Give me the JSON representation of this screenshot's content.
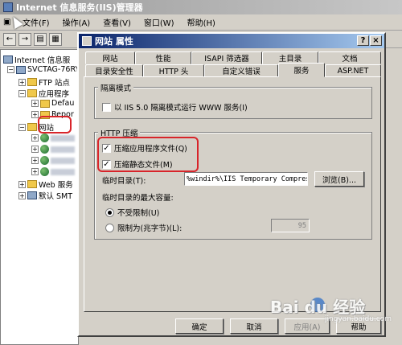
{
  "main_window": {
    "title": "Internet 信息服务(IIS)管理器",
    "menu": [
      "文件(F)",
      "操作(A)",
      "查看(V)",
      "窗口(W)",
      "帮助(H)"
    ],
    "tree": [
      "Internet 信息服",
      "SVCTAG-76RY",
      "FTP 站点",
      "应用程序",
      "Defau",
      "Repor",
      "网站",
      "Web 服务",
      "默认 SMT"
    ]
  },
  "dialog": {
    "title": "网站 属性",
    "tabs_row1": [
      "网站",
      "性能",
      "ISAPI 筛选器",
      "主目录",
      "文档"
    ],
    "tabs_row2": [
      "目录安全性",
      "HTTP 头",
      "自定义错误",
      "服务",
      "ASP.NET"
    ],
    "active_tab": "服务",
    "isolation_group": {
      "label": "隔离模式",
      "checkbox_label": "以 IIS 5.0 隔离模式运行 WWW 服务(I)",
      "checked": false
    },
    "compression_group": {
      "label": "HTTP 压缩",
      "compress_app_label": "压缩应用程序文件(Q)",
      "compress_app_checked": true,
      "compress_static_label": "压缩静态文件(M)",
      "compress_static_checked": true,
      "temp_dir_label": "临时目录(T):",
      "temp_dir_value": "%windir%\\IIS Temporary Compres",
      "browse_label": "浏览(B)...",
      "max_size_label": "临时目录的最大容量:",
      "unlimited_label": "不受限制(U)",
      "limited_label": "限制为(兆字节)(L):",
      "limit_value": "95",
      "selected": "unlimited"
    },
    "buttons": {
      "ok": "确定",
      "cancel": "取消",
      "apply": "应用(A)",
      "help": "帮助"
    }
  },
  "watermark": {
    "text": "Bai du 经验",
    "url": "jingyan.baidu.com"
  },
  "colors": {
    "highlight": "#d8242a",
    "dialog_title": "#0a246a"
  }
}
